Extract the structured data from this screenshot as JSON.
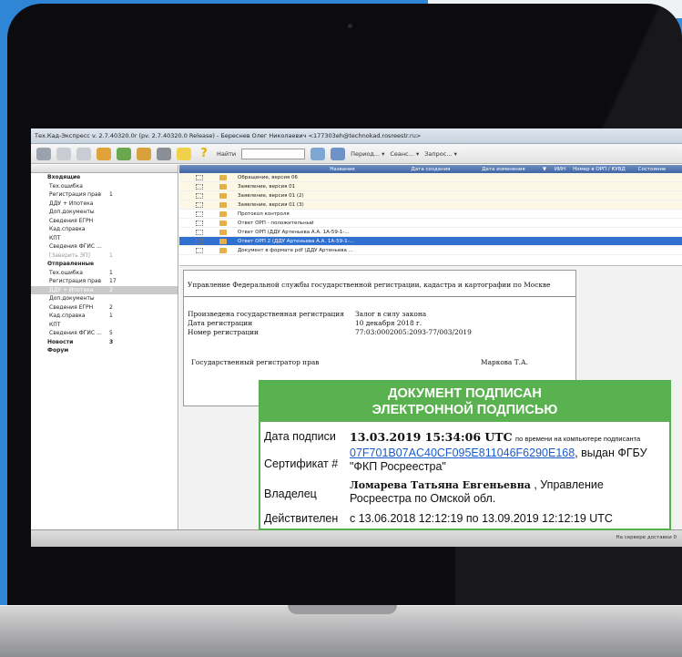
{
  "window": {
    "title": "Тех.Кад-Экспресс v. 2.7.40320.0r (pv. 2.7.40320.0 Release) - Береснев Олег Николаевич <177303eh@technokad.rosreestr.ru>"
  },
  "toolbar": {
    "find_label": "Найти",
    "period_label": "Период... ▾",
    "session_label": "Сеанс... ▾",
    "request_label": "Запрос... ▾"
  },
  "sidebar": {
    "items": [
      {
        "label": "Входящие",
        "count": "",
        "style": "bold"
      },
      {
        "label": "Тех.ошибка",
        "count": "",
        "style": ""
      },
      {
        "label": "Регистрация прав",
        "count": "1",
        "style": ""
      },
      {
        "label": "ДДУ + Ипотека",
        "count": "",
        "style": ""
      },
      {
        "label": "Доп.документы",
        "count": "",
        "style": ""
      },
      {
        "label": "Сведения ЕГРН",
        "count": "",
        "style": ""
      },
      {
        "label": "Кад.справка",
        "count": "",
        "style": ""
      },
      {
        "label": "КПТ",
        "count": "",
        "style": ""
      },
      {
        "label": "Сведения ФГИС ...",
        "count": "",
        "style": ""
      },
      {
        "label": "[Заверить ЭП]",
        "count": "1",
        "style": "dim"
      },
      {
        "label": "Отправленные",
        "count": "",
        "style": "bold"
      },
      {
        "label": "Тех.ошибка",
        "count": "1",
        "style": ""
      },
      {
        "label": "Регистрация прав",
        "count": "17",
        "style": ""
      },
      {
        "label": "ДДУ + Ипотека",
        "count": "2",
        "style": "sel"
      },
      {
        "label": "Доп.документы",
        "count": "",
        "style": ""
      },
      {
        "label": "Сведения ЕГРН",
        "count": "2",
        "style": ""
      },
      {
        "label": "Кад.справка",
        "count": "1",
        "style": ""
      },
      {
        "label": "КПТ",
        "count": "",
        "style": ""
      },
      {
        "label": "Сведения ФГИС ...",
        "count": "5",
        "style": ""
      },
      {
        "label": "Новости",
        "count": "3",
        "style": "bold"
      },
      {
        "label": "Форум",
        "count": "",
        "style": "bold"
      }
    ]
  },
  "table": {
    "columns": [
      "Название",
      "Дата создания",
      "Дата изменения",
      "▼",
      "ИИН",
      "Номер в ОРП / КУВД",
      "Состояние"
    ],
    "rows": [
      {
        "name": "Обращение, версия 06",
        "style": "yel"
      },
      {
        "name": "Заявление, версия 01",
        "style": "yel"
      },
      {
        "name": "Заявление, версия 01 (2)",
        "style": "yel"
      },
      {
        "name": "Заявление, версия 01 (3)",
        "style": "yel"
      },
      {
        "name": "Протокол контроля",
        "style": ""
      },
      {
        "name": "Ответ ОРП - положительный",
        "style": ""
      },
      {
        "name": "Ответ ОРП (ДДУ Артеньева А.А. 1А-59-1-...",
        "style": ""
      },
      {
        "name": "Ответ ОРП 2 (ДДУ Артеньева А.А. 1А-59-1-...",
        "style": "hl"
      },
      {
        "name": "Документ в формате pdf (ДДУ Артеньева ...",
        "style": ""
      }
    ]
  },
  "document": {
    "header": "Управление Федеральной службы государственной регистрации, кадастра и картографии по Москве",
    "reg_label": "Произведена государственная регистрация",
    "reg_value": "Залог в силу закона",
    "date_label": "Дата регистрации",
    "date_value": "10  декабря   2018 г.",
    "num_label": "Номер регистрации",
    "num_value": "77:03:0002005:2093-77/003/2019",
    "registrar_label": "Государственный регистратор прав",
    "registrar_value": "Маркова Т.А."
  },
  "status": {
    "text": "На сервере доставки 0"
  },
  "signature": {
    "title1": "ДОКУМЕНТ ПОДПИСАН",
    "title2": "ЭЛЕКТРОННОЙ ПОДПИСЬЮ",
    "date_label": "Дата подписи",
    "date_value": "13.03.2019 15:34:06 UTC",
    "date_note": "по времени на компьютере подписанта",
    "cert_label": "Сертификат #",
    "cert_value": "07F701B07AC40CF095E811046F6290E168",
    "cert_issuer_prefix": ", выдан ФГБУ",
    "cert_issuer": "\"ФКП Росреестра\"",
    "owner_label": "Владелец",
    "owner_name": "Ломарева Татьяна Евгеньевна",
    "owner_org1": "   , Управление",
    "owner_org2": "Росреестра по Омской обл.",
    "valid_label": "Действителен",
    "valid_value": "с 13.06.2018 12:12:19 по 13.09.2019 12:12:19 UTC"
  },
  "colors": {
    "background": "#2f86d6",
    "signature_green": "#5ab14f",
    "selection": "#3070d0"
  }
}
